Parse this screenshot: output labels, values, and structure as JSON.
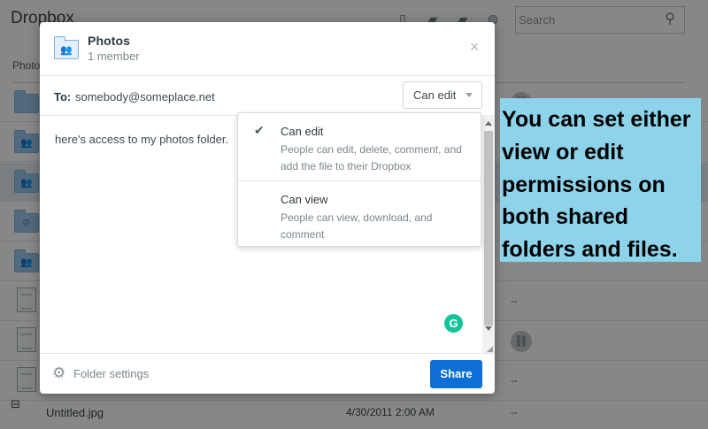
{
  "background": {
    "app_title": "Dropbox",
    "search_placeholder": "Search",
    "breadcrumb": "Photo",
    "rows": [
      {
        "kind": "folder",
        "icon": "",
        "meta": "link",
        "selected": false
      },
      {
        "kind": "folder",
        "icon": "people",
        "meta": "",
        "selected": false
      },
      {
        "kind": "folder",
        "icon": "people",
        "meta": "",
        "selected": true
      },
      {
        "kind": "folder",
        "icon": "shared",
        "meta": "",
        "selected": false
      },
      {
        "kind": "folder",
        "icon": "people",
        "meta": "",
        "selected": false
      },
      {
        "kind": "doc",
        "icon": "",
        "meta": "--",
        "selected": false
      },
      {
        "kind": "doc",
        "icon": "",
        "meta": "link",
        "selected": false
      },
      {
        "kind": "doc",
        "icon": "",
        "meta": "--",
        "selected": false
      }
    ],
    "last_file": {
      "name": "Untitled.jpg",
      "modified": "4/30/2011 2:00 AM",
      "meta": "--"
    }
  },
  "dialog": {
    "title": "Photos",
    "subtitle": "1 member",
    "close_symbol": "×",
    "to_label": "To:",
    "to_value": "somebody@someplace.net",
    "permission_button": "Can edit",
    "message": "here's access to my photos folder.",
    "footer": {
      "settings_label": "Folder settings",
      "share_label": "Share"
    }
  },
  "menu": {
    "items": [
      {
        "title": "Can edit",
        "description": "People can edit, delete, comment, and add the file to their Dropbox",
        "checked": true
      },
      {
        "title": "Can view",
        "description": "People can view, download, and comment",
        "checked": false
      }
    ]
  },
  "callout": {
    "text": "You can set either view or edit permissions on both shared folders and files."
  },
  "colors": {
    "accent": "#0d6fd5",
    "callout_bg": "#8dd3ea",
    "grammarly": "#15c39a"
  }
}
